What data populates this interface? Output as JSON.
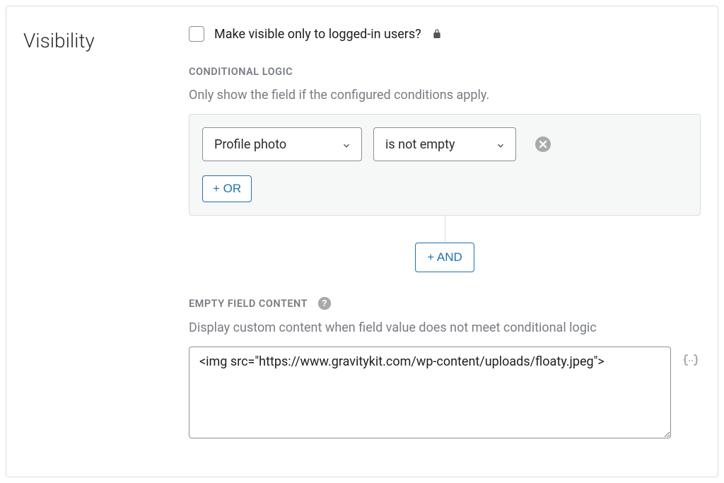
{
  "section": {
    "title": "Visibility"
  },
  "visibilityCheckbox": {
    "label": "Make visible only to logged-in users?"
  },
  "conditionalLogic": {
    "header": "CONDITIONAL LOGIC",
    "description": "Only show the field if the configured conditions apply.",
    "condition": {
      "field": "Profile photo",
      "operator": "is not empty"
    },
    "orButtonLabel": "+ OR",
    "andButtonLabel": "+ AND"
  },
  "emptyFieldContent": {
    "header": "EMPTY FIELD CONTENT",
    "description": "Display custom content when field value does not meet conditional logic",
    "textareaValue": "<img src=\"https://www.gravitykit.com/wp-content/uploads/floaty.jpeg\">"
  }
}
